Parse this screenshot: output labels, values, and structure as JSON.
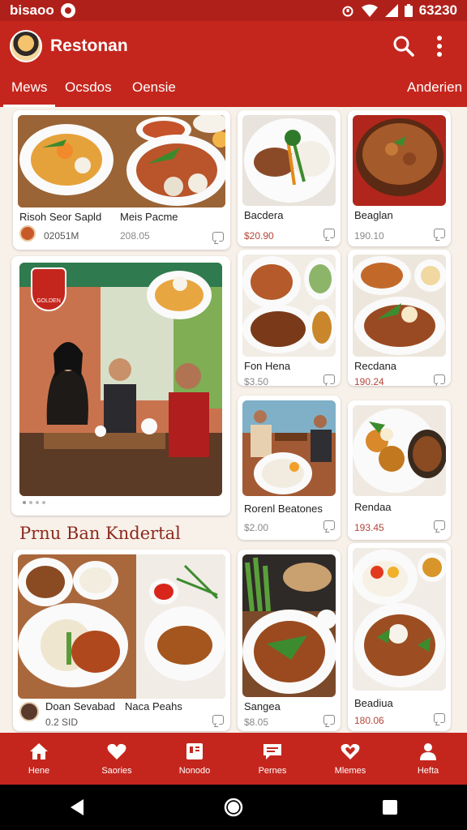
{
  "status_bar": {
    "left_text": "bisaoo",
    "right_text": "63230"
  },
  "app_bar": {
    "title": "Restonan",
    "search_icon": "search-icon",
    "more_icon": "more-vert-icon"
  },
  "tabs": [
    {
      "label": "Mews",
      "active": true
    },
    {
      "label": "Ocsdos",
      "active": false
    },
    {
      "label": "Oensie",
      "active": false
    },
    {
      "label": "Anderien",
      "active": false
    }
  ],
  "cards": {
    "top_wide": {
      "title_left": "Risoh Seor Sapld",
      "title_right": "Meis Pacme",
      "price_left": "02051M",
      "price_right": "208.05"
    },
    "top_mid": {
      "title": "Bacdera",
      "price": "$20.90"
    },
    "top_right": {
      "title": "Beaglan",
      "price": "190.10"
    },
    "feature": {
      "logo_text": "GOLDEN"
    },
    "mid_a": {
      "title": "Fon Hena",
      "price": "$3.50"
    },
    "mid_b": {
      "title": "Recdana",
      "price": "190.24"
    },
    "mid_c": {
      "title": "Rorenl Beatones",
      "price": "$2.00"
    },
    "mid_d": {
      "title": "Rendaa",
      "price": "193.45"
    },
    "bottom_wide": {
      "title_left": "Doan Sevabad",
      "title_right": "Naca Peahs",
      "price_left": "0.2 SID"
    },
    "bottom_mid": {
      "title": "Sangea",
      "price": "$8.05"
    },
    "bottom_right": {
      "title": "Beadiua",
      "price": "180.06"
    }
  },
  "section": {
    "title": "Prnu Ban Kndertal"
  },
  "bottom_nav": [
    {
      "label": "Hene",
      "icon": "home-icon"
    },
    {
      "label": "Saories",
      "icon": "heart-icon"
    },
    {
      "label": "Nonodo",
      "icon": "menu-book-icon"
    },
    {
      "label": "Pernes",
      "icon": "chat-icon"
    },
    {
      "label": "Mlemes",
      "icon": "heart-outline-icon"
    },
    {
      "label": "Hefta",
      "icon": "person-icon"
    }
  ],
  "colors": {
    "brand_red": "#c4261d",
    "dark_red": "#b0201a",
    "price_red": "#b4453a"
  }
}
